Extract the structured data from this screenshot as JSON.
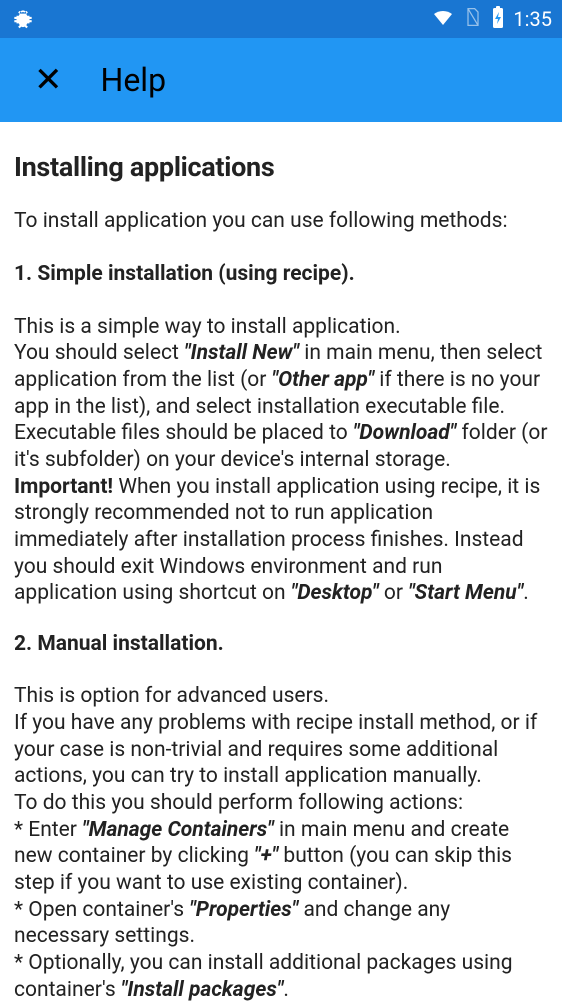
{
  "statusbar": {
    "time": "1:35"
  },
  "appbar": {
    "title": "Help"
  },
  "content": {
    "page_title": "Installing applications",
    "intro": "To install application you can use following methods:",
    "s1": {
      "heading": "1. Simple installation (using recipe).",
      "p1": "This is a simple way to install application.",
      "p2a": "You should select ",
      "p2b": "\"Install New\"",
      "p2c": " in main menu, then select application from the list (or ",
      "p2d": "\"Other app\"",
      "p2e": " if there is no your app in the list), and select installation executable file.",
      "p3a": "Executable files should be placed to ",
      "p3b": "\"Download\"",
      "p3c": " folder (or it's subfolder) on your device's internal storage.",
      "p4a": "Important!",
      "p4b": " When you install application using recipe, it is strongly recommended not to run application immediately after installation process finishes. Instead you should exit Windows environment and run application using shortcut on ",
      "p4c": "\"Desktop\"",
      "p4d": " or ",
      "p4e": "\"Start Menu\"",
      "p4f": "."
    },
    "s2": {
      "heading": "2. Manual installation.",
      "p1": "This is option for advanced users.",
      "p2": "If you have any problems with recipe install method, or if your case is non-trivial and requires some additional actions, you can try to install application manually.",
      "p3": "To do this you should perform following actions:",
      "b1a": "* Enter ",
      "b1b": "\"Manage Containers\"",
      "b1c": " in main menu and create new container by clicking ",
      "b1d": "\"+\"",
      "b1e": " button (you can skip this step if you want to use existing container).",
      "b2a": "* Open container's ",
      "b2b": "\"Properties\"",
      "b2c": " and change any necessary settings.",
      "b3a": "* Optionally, you can install additional packages using container's ",
      "b3b": "\"Install packages\"",
      "b3c": "."
    }
  }
}
